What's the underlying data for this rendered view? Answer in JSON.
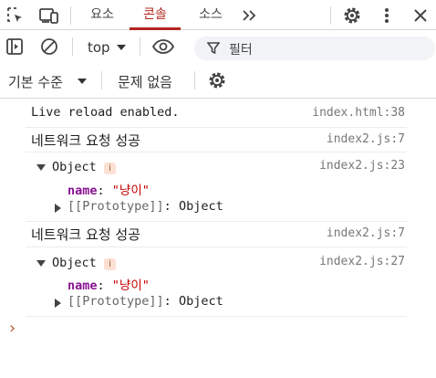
{
  "tabs": [
    {
      "label": "요소"
    },
    {
      "label": "콘솔"
    },
    {
      "label": "소스"
    }
  ],
  "toolbar": {
    "context": "top",
    "filter_placeholder": "필터",
    "levels": "기본 수준",
    "issues": "문제 없음"
  },
  "console": {
    "messages": [
      {
        "text": "Live reload enabled.",
        "source": "index.html:38"
      },
      {
        "text": "네트워크 요청 성공",
        "source": "index2.js:7"
      },
      {
        "object_label": "Object",
        "info": "i",
        "source": "index2.js:23",
        "prop_key": "name",
        "prop_sep": ":",
        "prop_value": "\"냥이\"",
        "proto": "[[Prototype]]",
        "proto_sep": ":",
        "proto_value": "Object"
      },
      {
        "text": "네트워크 요청 성공",
        "source": "index2.js:7"
      },
      {
        "object_label": "Object",
        "info": "i",
        "source": "index2.js:27",
        "prop_key": "name",
        "prop_sep": ":",
        "prop_value": "\"냥이\"",
        "proto": "[[Prototype]]",
        "proto_sep": ":",
        "proto_value": "Object"
      }
    ],
    "prompt": "›"
  },
  "colors": {
    "accent": "#b3261e",
    "key": "#881391",
    "string": "#c80000"
  }
}
